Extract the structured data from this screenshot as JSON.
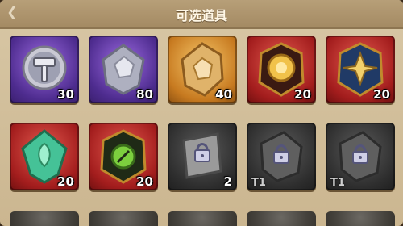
{
  "header": {
    "title": "可选道具"
  },
  "items": [
    {
      "name": "hammer",
      "count": "30",
      "tier": ""
    },
    {
      "name": "silver-ore",
      "count": "80",
      "tier": ""
    },
    {
      "name": "gold-ore",
      "count": "40",
      "tier": ""
    },
    {
      "name": "golden-emblem",
      "count": "20",
      "tier": ""
    },
    {
      "name": "star-emblem",
      "count": "20",
      "tier": ""
    },
    {
      "name": "leaf-gem",
      "count": "20",
      "tier": ""
    },
    {
      "name": "green-emblem",
      "count": "20",
      "tier": ""
    },
    {
      "name": "locked-scroll",
      "count": "2",
      "tier": ""
    },
    {
      "name": "locked-stone",
      "count": "",
      "tier": "T1"
    },
    {
      "name": "locked-stone",
      "count": "",
      "tier": "T1"
    }
  ],
  "colors": {
    "purple": "#4e2c8f",
    "gold": "#c77a20",
    "red": "#a31d1d",
    "gray": "#2e2e2e"
  }
}
